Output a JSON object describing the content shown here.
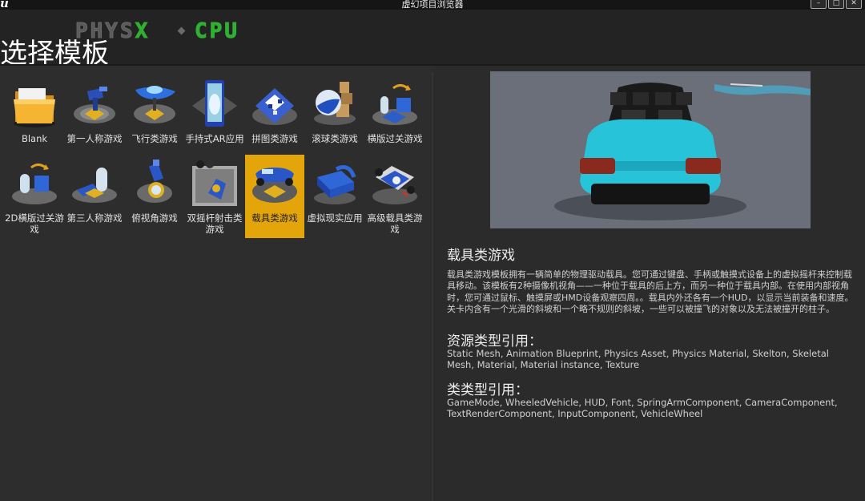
{
  "window": {
    "title": "虚幻项目浏览器",
    "logo": "u",
    "controls": [
      "–",
      "□",
      "✕"
    ]
  },
  "header": {
    "physx_label": "PHYS",
    "physx_x": "X",
    "cpu_label": "CPU",
    "page_title": "选择模板"
  },
  "templates": [
    {
      "label": "Blank",
      "icon": "folder-icon"
    },
    {
      "label": "第一人称游戏",
      "icon": "first-person-icon"
    },
    {
      "label": "飞行类游戏",
      "icon": "flying-ship-icon"
    },
    {
      "label": "手持式AR应用",
      "icon": "handheld-ar-icon"
    },
    {
      "label": "拼图类游戏",
      "icon": "puzzle-icon"
    },
    {
      "label": "滚球类游戏",
      "icon": "rolling-ball-icon"
    },
    {
      "label": "横版过关游戏",
      "icon": "side-scroller-icon"
    },
    {
      "label": "2D横版过关游戏",
      "icon": "side-scroller-2d-icon"
    },
    {
      "label": "第三人称游戏",
      "icon": "third-person-icon"
    },
    {
      "label": "俯视角游戏",
      "icon": "top-down-icon"
    },
    {
      "label": "双摇杆射击类游戏",
      "icon": "twin-stick-shooter-icon"
    },
    {
      "label": "载具类游戏",
      "icon": "vehicle-icon",
      "selected": true
    },
    {
      "label": "虚拟现实应用",
      "icon": "vr-headset-icon"
    },
    {
      "label": "高级载具类游戏",
      "icon": "advanced-vehicle-icon"
    }
  ],
  "details": {
    "title": "载具类游戏",
    "description": "载具类游戏模板拥有一辆简单的物理驱动载具。您可通过键盘、手柄或触摸式设备上的虚拟摇杆来控制载具移动。该模板有2种摄像机视角——一种位于载具的后上方，而另一种位于载具内部。在使用内部视角时，您可通过鼠标、触摸屏或HMD设备观察四周。。载具内外还各有一个HUD，以显示当前装备和速度。关卡内含有一个光滑的斜坡和一个略不规则的斜坡，一些可以被撞飞的对象以及无法被撞开的柱子。",
    "asset_title": "资源类型引用：",
    "asset_list": "Static Mesh, Animation Blueprint, Physics Asset, Physics Material, Skelton, Skeletal Mesh, Material, Material instance, Texture",
    "class_title": "类类型引用：",
    "class_list": "GameMode, WheeledVehicle, HUD, Font, SpringArmComponent, CameraComponent, TextRenderComponent, InputComponent, VehicleWheel"
  },
  "colors": {
    "selected": "#e3a50a",
    "cpu_green": "#2fb032",
    "car_cyan": "#27c3d8"
  }
}
